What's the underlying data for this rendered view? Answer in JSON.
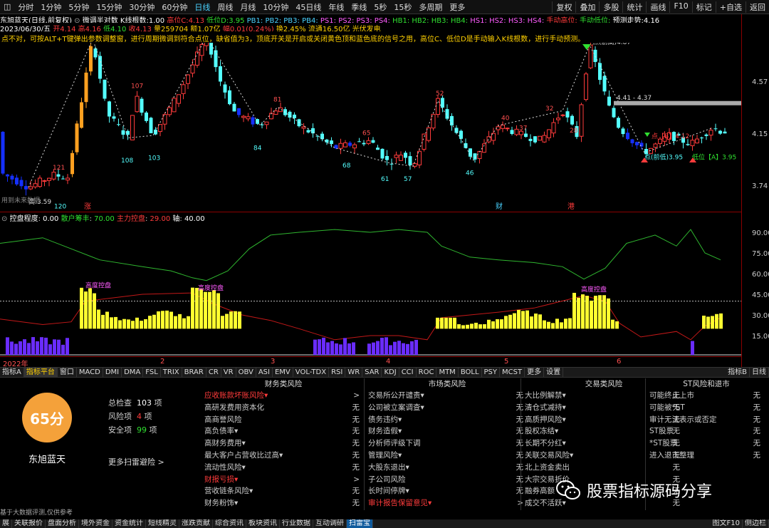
{
  "toolbar": {
    "items": [
      "分时",
      "1分钟",
      "5分钟",
      "15分钟",
      "30分钟",
      "60分钟",
      "日线",
      "周线",
      "月线",
      "10分钟",
      "45日线",
      "年线",
      "季线",
      "5秒",
      "15秒",
      "多周期",
      "更多"
    ],
    "active_index": 6,
    "right_items": [
      "复权",
      "叠加",
      "多股",
      "统计",
      "画线",
      "F10",
      "标记",
      "+自选",
      "返回"
    ]
  },
  "info": {
    "title": "东旭蓝天(日线,前复权)",
    "indicator": "微调半对数",
    "k_count_label": "K线根数:",
    "k_count": "1.00",
    "high_label": "高位C:",
    "high_value": "4.13",
    "low_label": "低位D:",
    "low_value": "3.95",
    "pb_labels": [
      "PB1:",
      "PB2:",
      "PB3:",
      "PB4:",
      "PS1:",
      "PS2:",
      "PS3:",
      "PS4:",
      "HB1:",
      "HB2:",
      "HB3:",
      "HB4:",
      "HS1:",
      "HS2:",
      "HS3:",
      "HS4:"
    ],
    "manual_high": "手动高位:",
    "manual_low": "手动低位:",
    "forecast_label": "预测走势:",
    "forecast_value": "4.16"
  },
  "quote": {
    "date": "2023/06/30/五",
    "open": "开4.14",
    "high": "高4.16",
    "low": "低4.10",
    "close": "收4.13",
    "volume": "量259704",
    "amount": "额1.07亿",
    "change": "幅0.01(0.24%)",
    "turnover": "换2.45%",
    "float": "流通16.50亿",
    "sector": "光伏发电"
  },
  "note": "点不对，可按ALT+T键弹出参数调整窗，进行周期微调到符合点位，缺省值为3，顶底开关是开启或关闭黄色顶和蓝色底的信号之用，高位C、低位D是手动输入K线根数，进行手动预测。",
  "price_axis": [
    "4.57",
    "4.15",
    "3.74"
  ],
  "chart_labels": {
    "peaks": [
      "121",
      "107",
      "81",
      "65",
      "52",
      "40",
      "37",
      "32",
      "28",
      "25"
    ],
    "troughs": [
      "120",
      "108",
      "103",
      "84",
      "68",
      "61",
      "57",
      "46"
    ],
    "top_label": "点(前高)4.87",
    "range_label": "4.41 - 4.37",
    "c_label": "点【B】4.12",
    "low_label": "点(前低)3.95",
    "a_label": "低位【A】3.95",
    "left_label": "高:3.59",
    "left_note": "用到未来数据",
    "markers": [
      "涨",
      "财",
      "港"
    ]
  },
  "sub": {
    "title": "控盘程度",
    "title_value": "0.00",
    "retail_label": "散户筹丰",
    "retail_value": "70.00",
    "main_label": "主力控盘",
    "main_value": "29.00",
    "axis_label": "轴",
    "axis_value": "40.00",
    "axis_ticks": [
      "90.00",
      "75.00",
      "60.00",
      "45.00",
      "30.00",
      "15.00"
    ],
    "tag": "高度控盘"
  },
  "time_axis": [
    "2022年",
    "2",
    "3",
    "4",
    "5",
    "6"
  ],
  "tabs": [
    "指标A",
    "指标平台",
    "窗口",
    "MACD",
    "DMI",
    "DMA",
    "FSL",
    "TRIX",
    "BRAR",
    "CR",
    "VR",
    "OBV",
    "ASI",
    "EMV",
    "VOL-TDX",
    "RSI",
    "WR",
    "SAR",
    "KDJ",
    "CCI",
    "ROC",
    "MTM",
    "BOLL",
    "PSY",
    "MCST",
    "更多",
    "设置"
  ],
  "tabs_right": [
    "指标B",
    "日线"
  ],
  "score": {
    "value": "65分",
    "name": "东旭蓝天",
    "total_label": "总检查",
    "total": "103",
    "risk_label": "风险项",
    "risk": "4",
    "safe_label": "安全项",
    "safe": "99",
    "unit": "项",
    "more": "更多扫雷避险 >"
  },
  "risk_columns": [
    {
      "title": "财务类风险",
      "rows": [
        {
          "label": "应收账款坏账风险▾",
          "value": ">",
          "risk": true
        },
        {
          "label": "高研发费用资本化",
          "value": "无"
        },
        {
          "label": "高商誉风险",
          "value": "无"
        },
        {
          "label": "高负债率▾",
          "value": "无"
        },
        {
          "label": "高财务费用▾",
          "value": "无"
        },
        {
          "label": "最大客户占营收比过高▾",
          "value": "无"
        },
        {
          "label": "流动性风险▾",
          "value": "无"
        },
        {
          "label": "财报亏损▾",
          "value": ">",
          "risk": true
        },
        {
          "label": "营收链条风险▾",
          "value": "无"
        },
        {
          "label": "财务粉饰▾",
          "value": "无"
        }
      ]
    },
    {
      "title": "市场类风险",
      "rows": [
        {
          "label": "交易所公开谴责▾",
          "value": "无"
        },
        {
          "label": "公司被立案调查▾",
          "value": "无"
        },
        {
          "label": "债务违约▾",
          "value": "无"
        },
        {
          "label": "财务造假▾",
          "value": "无"
        },
        {
          "label": "分析师评级下调",
          "value": "无"
        },
        {
          "label": "管理风险▾",
          "value": "无"
        },
        {
          "label": "大股东退出▾",
          "value": "无"
        },
        {
          "label": "子公司风险",
          "value": "无"
        },
        {
          "label": "长时间停牌▾",
          "value": "无"
        },
        {
          "label": "审计报告保留意见▾",
          "value": ">",
          "risk": true
        }
      ]
    },
    {
      "title": "交易类风险",
      "rows": [
        {
          "label": "大比例解禁▾",
          "value": "无"
        },
        {
          "label": "清仓式减持▾",
          "value": "无"
        },
        {
          "label": "高质押风险▾",
          "value": "无"
        },
        {
          "label": "股权冻结▾",
          "value": "无"
        },
        {
          "label": "长期不分红▾",
          "value": "无"
        },
        {
          "label": "关联交易风险▾",
          "value": "无"
        },
        {
          "label": "北上资金卖出",
          "value": "无"
        },
        {
          "label": "大宗交易折价",
          "value": "无"
        },
        {
          "label": "融券高额",
          "value": "无"
        },
        {
          "label": "成交不活跃▾",
          "value": "无"
        }
      ]
    },
    {
      "title": "ST风险和退市",
      "rows": [
        {
          "label": "可能终止上市",
          "value": "无"
        },
        {
          "label": "可能被*ST",
          "value": "无"
        },
        {
          "label": "审计无法表示或否定",
          "value": "无"
        },
        {
          "label": "ST股票",
          "value": "无"
        },
        {
          "label": "*ST股票",
          "value": "无"
        },
        {
          "label": "进入退市整理",
          "value": "无"
        }
      ]
    }
  ],
  "footnote": "基于大数据评测,仅供参考",
  "watermark": "股票指标源码分享",
  "bottom_tabs": [
    "展",
    "关联报价",
    "盘面分析",
    "境外资金",
    "资金统计",
    "短线精灵",
    "涨跌贡献",
    "综合资讯",
    "板块资讯",
    "行业数据",
    "互动调研",
    "扫雷宝"
  ],
  "bottom_right": [
    "图文F10",
    "侧边栏"
  ],
  "colors": {
    "up": "#ff3b3b",
    "down": "#54ffff",
    "yellow": "#ffff30",
    "purple": "#6a2cff",
    "green_line": "#2fb52f",
    "red_line": "#c21818",
    "score": "#f4a13a"
  }
}
